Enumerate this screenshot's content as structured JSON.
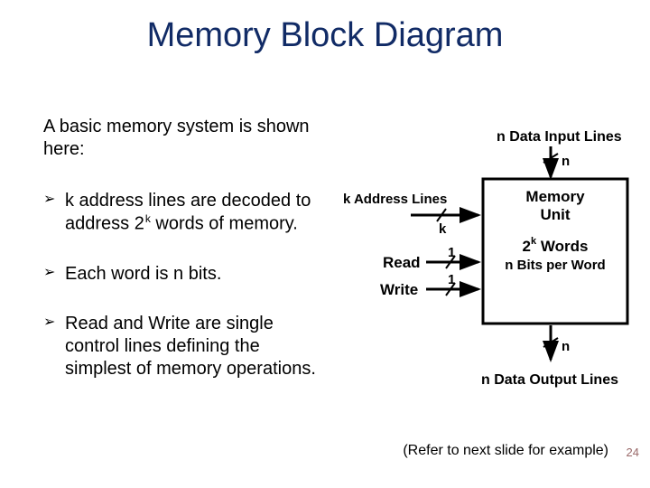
{
  "title": "Memory Block Diagram",
  "intro": "A basic memory system is shown here:",
  "bullets": {
    "b1_1": "k address lines are decoded to address 2",
    "b1_sup": "k",
    "b1_2": " words of memory.",
    "b2": "Each word is n bits.",
    "b3": "Read and Write are single control lines defining the simplest of memory operations."
  },
  "caption": "(Refer to next slide for example)",
  "page": "24",
  "diagram": {
    "top_label": "n Data Input Lines",
    "top_n": "n",
    "addr_label": "k Address Lines",
    "addr_k": "k",
    "read_label": "Read",
    "read_1": "1",
    "write_label": "Write",
    "write_1": "1",
    "block_line1": "Memory",
    "block_line2": "Unit",
    "block_line3a": "2",
    "block_line3sup": "k",
    "block_line3b": " Words",
    "block_line4": "n Bits per Word",
    "bottom_n": "n",
    "bottom_label": "n Data Output Lines"
  }
}
